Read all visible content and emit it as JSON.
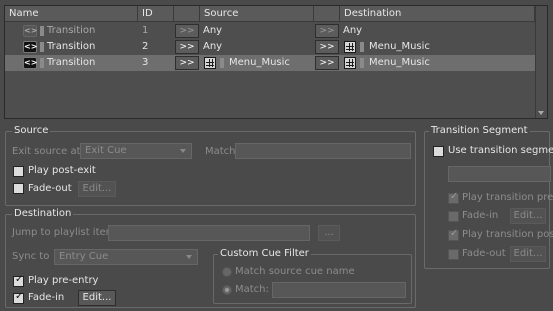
{
  "grid": {
    "headers": {
      "name": "Name",
      "id": "ID",
      "source": "Source",
      "destination": "Destination"
    },
    "rows": [
      {
        "name": "Transition",
        "id": "1",
        "arrow1": ">>",
        "source": "Any",
        "arrow2": ">>",
        "destination": "Any",
        "faded": true,
        "selected": false
      },
      {
        "name": "Transition",
        "id": "2",
        "arrow1": ">>",
        "source": "Any",
        "arrow2": ">>",
        "destination": "Menu_Music",
        "faded": false,
        "selected": false
      },
      {
        "name": "Transition",
        "id": "3",
        "arrow1": ">>",
        "source": "Menu_Music",
        "arrow2": ">>",
        "destination": "Menu_Music",
        "faded": false,
        "selected": true
      }
    ]
  },
  "source": {
    "title": "Source",
    "exit_source_label": "Exit source at",
    "exit_source_value": "Exit Cue",
    "match_label": "Match:",
    "play_post_exit": "Play post-exit",
    "fade_out": "Fade-out",
    "edit": "Edit..."
  },
  "destination": {
    "title": "Destination",
    "jump_label": "Jump to playlist item",
    "browse": "...",
    "sync_label": "Sync to",
    "sync_value": "Entry Cue",
    "play_pre_entry": "Play pre-entry",
    "fade_in": "Fade-in",
    "edit": "Edit...",
    "custom_cue_title": "Custom Cue Filter",
    "match_source_cue": "Match source cue name",
    "match_label": "Match:"
  },
  "segment": {
    "title": "Transition Segment",
    "use_segment": "Use transition segment",
    "play_pre": "Play transition pre-en",
    "fade_in": "Fade-in",
    "edit1": "Edit...",
    "play_post": "Play transition post-ex",
    "fade_out": "Fade-out",
    "edit2": "Edit..."
  }
}
